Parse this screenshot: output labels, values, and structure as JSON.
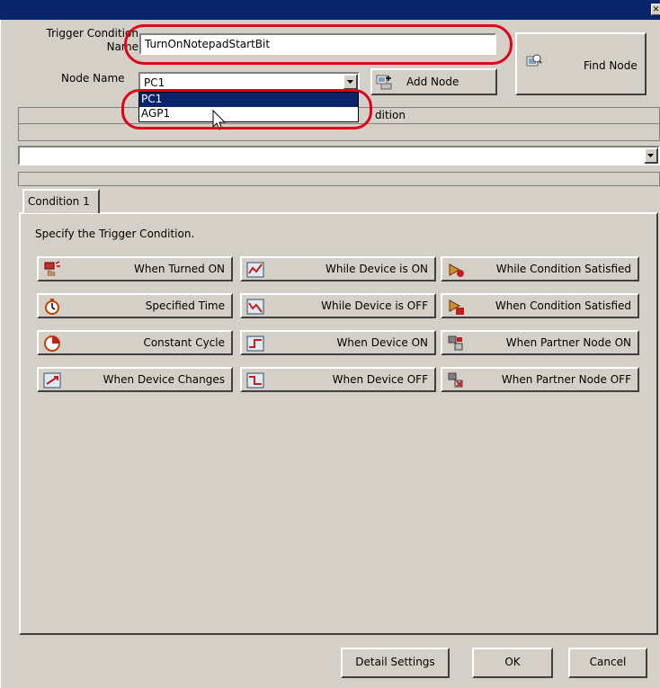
{
  "window": {
    "close_glyph": "✕"
  },
  "form": {
    "trigger_label_line1": "Trigger Condition",
    "trigger_label_line2": "Name",
    "trigger_value": "TurnOnNotepadStartBit",
    "node_label": "Node Name",
    "node_value": "PC1",
    "add_node_label": "Add Node",
    "find_node_label": "Find Node"
  },
  "dropdown": {
    "options": [
      "PC1",
      "AGP1"
    ],
    "selected": "PC1",
    "header_fragment": "dition"
  },
  "tabs": [
    {
      "label": "Condition 1"
    }
  ],
  "panel": {
    "instruction": "Specify the Trigger Condition."
  },
  "conditions": [
    {
      "label": "When Turned ON",
      "icon": "hand-touch-icon"
    },
    {
      "label": "While Device is ON",
      "icon": "device-on-icon"
    },
    {
      "label": "While Condition Satisfied",
      "icon": "condition-icon"
    },
    {
      "label": "Specified Time",
      "icon": "stopwatch-icon"
    },
    {
      "label": "While Device is OFF",
      "icon": "device-off-icon"
    },
    {
      "label": "When Condition Satisfied",
      "icon": "condition-ok-icon"
    },
    {
      "label": "Constant Cycle",
      "icon": "cycle-clock-icon"
    },
    {
      "label": "When Device ON",
      "icon": "device-turn-on-icon"
    },
    {
      "label": "When Partner Node ON",
      "icon": "partner-node-on-icon"
    },
    {
      "label": "When Device Changes",
      "icon": "device-change-icon"
    },
    {
      "label": "When Device OFF",
      "icon": "device-turn-off-icon"
    },
    {
      "label": "When Partner Node OFF",
      "icon": "partner-node-off-icon"
    }
  ],
  "footer": {
    "detail_label": "Detail Settings",
    "ok_label": "OK",
    "cancel_label": "Cancel"
  },
  "colors": {
    "title_bar": "#0a246a",
    "face": "#d4d0c8",
    "highlight": "#e0001a",
    "selection": "#0a246a"
  }
}
